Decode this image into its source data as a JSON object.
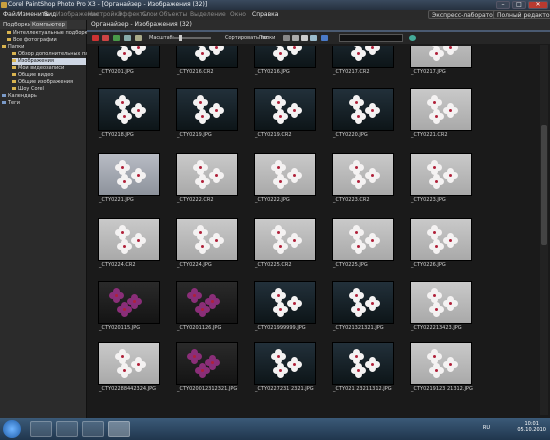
{
  "window": {
    "title": "Corel PaintShop Photo Pro X3 - [Органайзер - Изображения (32)]",
    "buttons": [
      "–",
      "□",
      "✕"
    ]
  },
  "menu": {
    "items": [
      "Файл",
      "Изменить",
      "Вид",
      "Изображение",
      "Настройка",
      "Эффекты",
      "Слои",
      "Объекты",
      "Выделение",
      "Окно",
      "Справка"
    ],
    "dim": [
      false,
      false,
      false,
      true,
      true,
      true,
      true,
      true,
      true,
      true,
      false
    ]
  },
  "modes": {
    "lab": "Экспресс-лаборатория",
    "full": "Полный редактор"
  },
  "left_tabs": [
    "Подборки",
    "Компьютер"
  ],
  "tree": [
    {
      "label": "Интеллектуальные подборки",
      "indent": 1,
      "icon": "folder",
      "selected": false
    },
    {
      "label": "Все фотографии",
      "indent": 1,
      "icon": "folder",
      "selected": false
    },
    {
      "label": "Папки",
      "indent": 0,
      "icon": "folder",
      "selected": false
    },
    {
      "label": "Обзор дополнительных папок",
      "indent": 2,
      "icon": "folder",
      "selected": false
    },
    {
      "label": "Изображения",
      "indent": 2,
      "icon": "folder",
      "selected": true
    },
    {
      "label": "Мои видеозаписи",
      "indent": 2,
      "icon": "folder",
      "selected": false
    },
    {
      "label": "Общие видео",
      "indent": 2,
      "icon": "folder",
      "selected": false
    },
    {
      "label": "Общие изображения",
      "indent": 2,
      "icon": "folder",
      "selected": false
    },
    {
      "label": "Шоу Corel",
      "indent": 2,
      "icon": "folder",
      "selected": false
    },
    {
      "label": "Календарь",
      "indent": 0,
      "icon": "calendar",
      "selected": false
    },
    {
      "label": "Теги",
      "indent": 0,
      "icon": "tag",
      "selected": false
    }
  ],
  "main": {
    "path": "Органайзер - Изображения (32)",
    "toolbar": {
      "scale_label": "Масштаб:",
      "sort_label": "Сортировать по:",
      "sort_value": "Папки"
    }
  },
  "thumbnails": [
    {
      "name": "_CTY0201.JPG",
      "style": "dark"
    },
    {
      "name": "_CTY0216.CR2",
      "style": "dark"
    },
    {
      "name": "_CTY0216.JPG",
      "style": "dark"
    },
    {
      "name": "_CTY0217.CR2",
      "style": "dark"
    },
    {
      "name": "_CTY0217.JPG",
      "style": "light"
    },
    {
      "name": "_CTY0218.JPG",
      "style": "dark"
    },
    {
      "name": "_CTY0219.JPG",
      "style": "dark"
    },
    {
      "name": "_CTY0219.CR2",
      "style": "dark"
    },
    {
      "name": "_CTY0220.JPG",
      "style": "dark"
    },
    {
      "name": "_CTY0221.CR2",
      "style": "light"
    },
    {
      "name": "_CTY0221.JPG",
      "style": "gray"
    },
    {
      "name": "_CTY0222.CR2",
      "style": "light"
    },
    {
      "name": "_CTY0222.JPG",
      "style": "light"
    },
    {
      "name": "_CTY0223.CR2",
      "style": "light"
    },
    {
      "name": "_CTY0223.JPG",
      "style": "light"
    },
    {
      "name": "_CTY0224.CR2",
      "style": "light"
    },
    {
      "name": "_CTY0224.JPG",
      "style": "light"
    },
    {
      "name": "_CTY0225.CR2",
      "style": "light"
    },
    {
      "name": "_CTY0225.JPG",
      "style": "light"
    },
    {
      "name": "_CTY0226.JPG",
      "style": "light"
    },
    {
      "name": "_CTY020115.JPG",
      "style": "purple"
    },
    {
      "name": "_CTY0201126.JPG",
      "style": "purple"
    },
    {
      "name": "_CTY021999999.JPG",
      "style": "dark"
    },
    {
      "name": "_CTY021321321.JPG",
      "style": "dark"
    },
    {
      "name": "_CTY022213423.JPG",
      "style": "light"
    },
    {
      "name": "_CTY02288442324.JPG",
      "style": "light"
    },
    {
      "name": "_CTY020012312321.JPG",
      "style": "purple"
    },
    {
      "name": "_CTY0227231 2321.JPG",
      "style": "dark"
    },
    {
      "name": "_CTY021 23211312.JPG",
      "style": "dark"
    },
    {
      "name": "_CTY0219123 21312.JPG",
      "style": "light"
    }
  ],
  "taskbar": {
    "lang": "RU",
    "time": "10:01",
    "date": "05.10.2010"
  },
  "colors": {
    "accent": "#7a9ac8",
    "background": "#1a1a1a"
  }
}
